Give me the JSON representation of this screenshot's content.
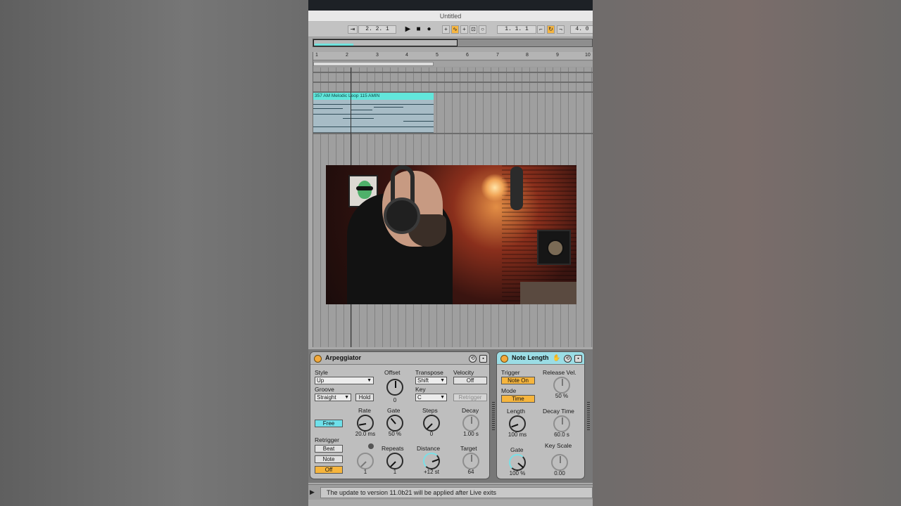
{
  "window": {
    "title": "Untitled"
  },
  "transport": {
    "position": "2.  2.  1",
    "loop_start": "1.  1.  1",
    "loop_length": "4.  0"
  },
  "ruler": {
    "bars": [
      "1",
      "2",
      "3",
      "4",
      "5",
      "6",
      "7",
      "8",
      "9",
      "10"
    ]
  },
  "clip": {
    "name": "357 AM Melodic Loop 115 AMIN",
    "color": "#62e6db"
  },
  "arpeggiator": {
    "title": "Arpeggiator",
    "style_label": "Style",
    "style_value": "Up",
    "groove_label": "Groove",
    "groove_value": "Straight",
    "hold_label": "Hold",
    "offset_label": "Offset",
    "offset_value": "0",
    "transpose_label": "Transpose",
    "transpose_value": "Shift",
    "key_label": "Key",
    "key_value": "C",
    "velocity_label": "Velocity",
    "velocity_value": "Off",
    "retrigger_button": "Retrigger",
    "rate_label": "Rate",
    "rate_value": "20.0 ms",
    "gate_label": "Gate",
    "gate_value": "50 %",
    "steps_label": "Steps",
    "steps_value": "0",
    "decay_label": "Decay",
    "decay_value": "1.00 s",
    "free_label": "Free",
    "retrigger_label": "Retrigger",
    "retrig_beat": "Beat",
    "retrig_note": "Note",
    "retrig_off": "Off",
    "retrig_knob_value": "1",
    "repeats_label": "Repeats",
    "repeats_value": "1",
    "distance_label": "Distance",
    "distance_value": "+12 st",
    "target_label": "Target",
    "target_value": "64"
  },
  "note_length": {
    "title": "Note Length",
    "trigger_label": "Trigger",
    "trigger_value": "Note On",
    "release_vel_label": "Release Vel.",
    "release_vel_value": "50 %",
    "mode_label": "Mode",
    "mode_value": "Time",
    "length_label": "Length",
    "length_value": "100 ms",
    "decay_time_label": "Decay Time",
    "decay_time_value": "60.0 s",
    "gate_label": "Gate",
    "gate_value": "100 %",
    "key_scale_label": "Key Scale",
    "key_scale_value": "0.00"
  },
  "status": {
    "message": "The update to version 11.0b21 will be applied after Live exits"
  },
  "colors": {
    "accent_yellow": "#f6b53d",
    "accent_cyan": "#6fe0ea",
    "clip": "#62e6db"
  }
}
